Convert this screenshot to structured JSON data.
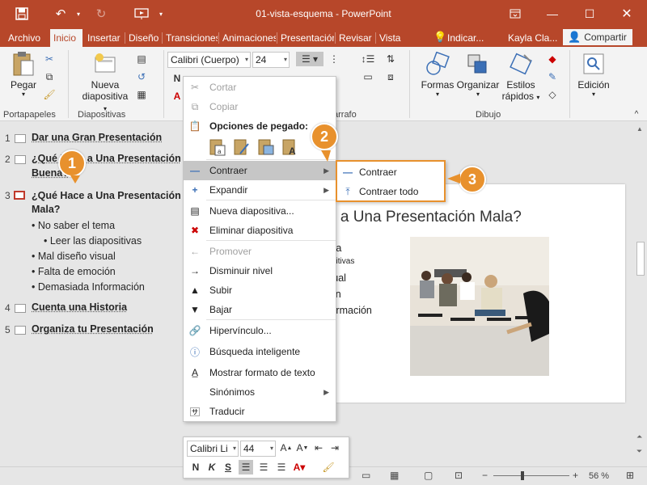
{
  "titlebar": {
    "title": "01-vista-esquema  -  PowerPoint",
    "colors": {
      "accent": "#b7472a",
      "callout": "#e8912d"
    }
  },
  "tabs": [
    "Archivo",
    "Inicio",
    "Insertar",
    "Diseño",
    "Transiciones",
    "Animaciones",
    "Presentación",
    "Revisar",
    "Vista"
  ],
  "tell_me": "Indicar...",
  "user": "Kayla Cla...",
  "share": "Compartir",
  "ribbon": {
    "paste": "Pegar",
    "new_slide_1": "Nueva",
    "new_slide_2": "diapositiva",
    "font_name": "Calibri (Cuerpo)",
    "font_size": "24",
    "shapes": "Formas",
    "arrange": "Organizar",
    "quick_styles_1": "Estilos",
    "quick_styles_2": "rápidos",
    "editing": "Edición",
    "groups": {
      "clipboard": "Portapapeles",
      "slides": "Diapositivas",
      "paragraph": "árrafo",
      "drawing": "Dibujo"
    }
  },
  "outline": {
    "slides": [
      {
        "num": "1",
        "title": "Dar una Gran Presentación"
      },
      {
        "num": "2",
        "title_line1": "¿Qué Hace a Una Presentación",
        "title_line2": "Buena?"
      },
      {
        "num": "3",
        "title_line1": "¿Qué Hace a Una Presentación",
        "title_line2": "Mala?"
      },
      {
        "num": "4",
        "title": "Cuenta una Historia"
      },
      {
        "num": "5",
        "title": "Organiza tu Presentación"
      }
    ],
    "bullets": [
      "No saber el tema",
      "Leer las diapositivas",
      "Mal diseño visual",
      "Falta de emoción",
      "Demasiada Información"
    ]
  },
  "slide": {
    "title": "e a Una Presentación Mala?",
    "bullets": [
      "ma",
      "ositivas",
      "sual",
      "ión",
      "formación"
    ]
  },
  "context_menu": {
    "cut": "Cortar",
    "copy": "Copiar",
    "paste_options": "Opciones de pegado:",
    "collapse": "Contraer",
    "expand": "Expandir",
    "new_slide": "Nueva diapositiva...",
    "delete_slide": "Eliminar diapositiva",
    "promote": "Promover",
    "demote": "Disminuir nivel",
    "move_up": "Subir",
    "move_down": "Bajar",
    "hyperlink": "Hipervínculo...",
    "smart_lookup": "Búsqueda inteligente",
    "show_formatting": "Mostrar formato de texto",
    "synonyms": "Sinónimos",
    "translate": "Traducir"
  },
  "submenu": {
    "collapse": "Contraer",
    "collapse_all": "Contraer todo"
  },
  "callouts": [
    "1",
    "2",
    "3"
  ],
  "mini_toolbar": {
    "font": "Calibri Li",
    "size": "44"
  },
  "status": {
    "zoom": "56 %"
  }
}
